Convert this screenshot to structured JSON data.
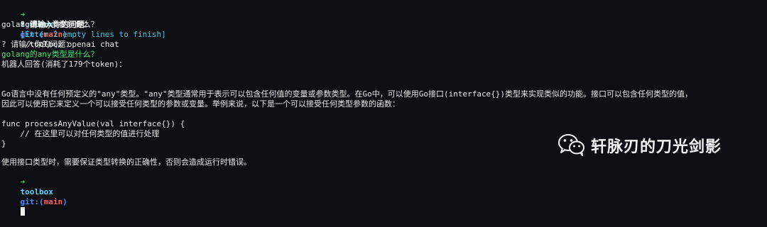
{
  "prompt": {
    "arrow": "➜",
    "dir": "toolbox",
    "git_label": "git:(",
    "branch": "main",
    "git_close": ")"
  },
  "command": "./toolbox openai chat",
  "q1": {
    "label": "? 请输入你的问题：",
    "hint": "[Enter 2 empty lines to finish]",
    "answer": "golang的any类型是什么？"
  },
  "q2": {
    "label": "? 请输入你的问题：",
    "answer": "golang的any类型是什么？"
  },
  "robot_reply": "机器人回答(消耗了179个token)：",
  "body": {
    "para1_line1": "Go语言中没有任何预定义的\"any\"类型。\"any\"类型通常用于表示可以包含任何值的变量或参数类型。在Go中，可以使用Go接口(interface{})类型来实现类似的功能。接口可以包含任何类型的值，",
    "para1_line2": "因此可以使用它来定义一个可以接受任何类型的参数或变量。举例来说，以下是一个可以接受任何类型参数的函数：",
    "code_line1": "func processAnyValue(val interface{}) {",
    "code_line2": "    // 在这里可以对任何类型的值进行处理",
    "code_line3": "}",
    "para2": "使用接口类型时，需要保证类型转换的正确性，否则会造成运行时错误。"
  },
  "watermark": {
    "icon": "wechat-icon",
    "text": "轩脉刃的刀光剑影"
  }
}
